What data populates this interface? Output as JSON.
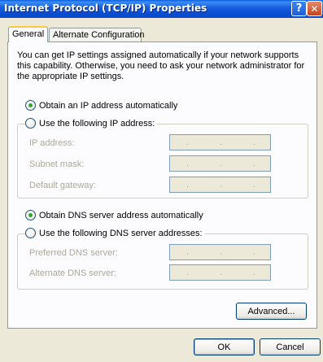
{
  "window": {
    "title": "Internet Protocol (TCP/IP) Properties",
    "help_glyph": "?",
    "close_glyph": "✕"
  },
  "tabs": [
    {
      "label": "General",
      "active": true
    },
    {
      "label": "Alternate Configuration",
      "active": false
    }
  ],
  "description": "You can get IP settings assigned automatically if your network supports this capability. Otherwise, you need to ask your network administrator for the appropriate IP settings.",
  "ip_section": {
    "auto_label": "Obtain an IP address automatically",
    "auto_selected": true,
    "manual_label": "Use the following IP address:",
    "fields": [
      {
        "label": "IP address:",
        "value": ""
      },
      {
        "label": "Subnet mask:",
        "value": ""
      },
      {
        "label": "Default gateway:",
        "value": ""
      }
    ]
  },
  "dns_section": {
    "auto_label": "Obtain DNS server address automatically",
    "auto_selected": true,
    "manual_label": "Use the following DNS server addresses:",
    "fields": [
      {
        "label": "Preferred DNS server:",
        "value": ""
      },
      {
        "label": "Alternate DNS server:",
        "value": ""
      }
    ]
  },
  "buttons": {
    "advanced": "Advanced...",
    "ok": "OK",
    "cancel": "Cancel"
  },
  "ip_dots": "."
}
